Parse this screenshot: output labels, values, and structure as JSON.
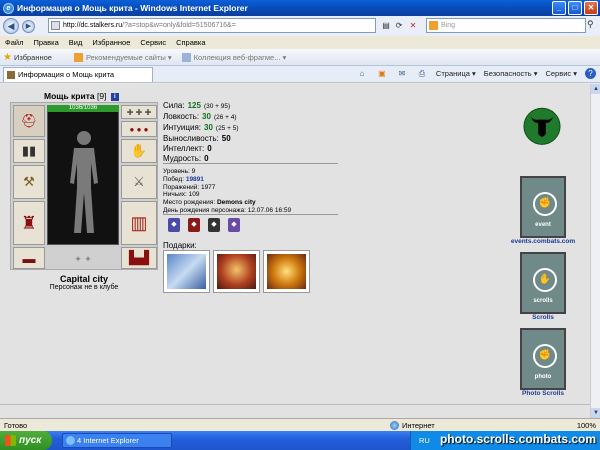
{
  "window": {
    "title": "Информация о Мощь крита - Windows Internet Explorer"
  },
  "address": {
    "url_host": "http://dc.stalkers.ru",
    "url_path": "/?a=stop&w=only&fold=51506716&=",
    "search_placeholder": "Bing"
  },
  "menu": {
    "items": [
      "Файл",
      "Правка",
      "Вид",
      "Избранное",
      "Сервис",
      "Справка"
    ]
  },
  "favorites": {
    "label": "Избранное",
    "suggested": "Рекомендуемые сайты ▾",
    "gallery": "Коллекция веб-фрагме... ▾"
  },
  "tab": {
    "title": "Информация о Мощь крита"
  },
  "commands": {
    "page": "Страница ▾",
    "safety": "Безопасность ▾",
    "tools": "Сервис ▾"
  },
  "character": {
    "name": "Мощь крита",
    "level": "[9]",
    "hp": "1036/1036",
    "city": "Capital city",
    "club": "Персонаж не в клубе"
  },
  "stats": [
    {
      "label": "Сила:",
      "value": "125",
      "bonus": "(30 + 95)",
      "color": "#12711b"
    },
    {
      "label": "Ловкость:",
      "value": "30",
      "bonus": "(26 + 4)",
      "color": "#12711b"
    },
    {
      "label": "Интуиция:",
      "value": "30",
      "bonus": "(25 + 5)",
      "color": "#12711b"
    },
    {
      "label": "Выносливость:",
      "value": "50",
      "bonus": "",
      "color": "#000000"
    },
    {
      "label": "Интеллект:",
      "value": "0",
      "bonus": "",
      "color": "#000000"
    },
    {
      "label": "Мудрость:",
      "value": "0",
      "bonus": "",
      "color": "#000000"
    }
  ],
  "info": {
    "level_label": "Уровень:",
    "level_value": "9",
    "wins_label": "Побед:",
    "wins_value": "19891",
    "losses_label": "Поражений:",
    "losses_value": "1977",
    "draws_label": "Ничьих:",
    "draws_value": "109",
    "birthplace_label": "Место рождения:",
    "birthplace_value": "Demons city",
    "birthday_label": "День рождения персонажа:",
    "birthday_value": "12.07.06 16:59"
  },
  "gifts": {
    "label": "Подарки:"
  },
  "sidebar": {
    "events": "events.combats.com",
    "scrolls": "Scrolls",
    "photo": "Photo Scrolls",
    "banner_events": "event",
    "banner_scrolls": "scrolls",
    "banner_photo": "photo"
  },
  "status": {
    "ready": "Готово",
    "zone": "Интернет",
    "zoom": "100%"
  },
  "taskbar": {
    "start": "пуск",
    "window": "4 Internet Explorer",
    "lang": "RU",
    "watermark": "photo.scrolls.combats.com"
  },
  "colors": {
    "green_stat": "#12711b",
    "link_blue": "#1a3a9a",
    "bull_green": "#1f7a2b"
  }
}
